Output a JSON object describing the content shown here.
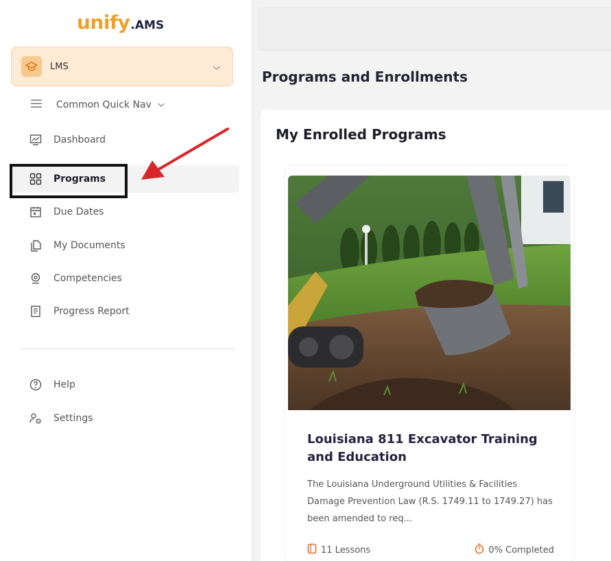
{
  "logo": {
    "main": "unify",
    "sub": ".AMS"
  },
  "module_select": {
    "label": "LMS",
    "icon": "graduation-cap-icon"
  },
  "quick_nav": {
    "label": "Common Quick Nav"
  },
  "nav": [
    {
      "label": "Dashboard",
      "icon": "dashboard-chart-icon"
    },
    {
      "label": "Programs",
      "icon": "grid-icon",
      "active": true
    },
    {
      "label": "Due Dates",
      "icon": "calendar-icon"
    },
    {
      "label": "My Documents",
      "icon": "documents-icon"
    },
    {
      "label": "Competencies",
      "icon": "badge-icon"
    },
    {
      "label": "Progress Report",
      "icon": "report-icon"
    }
  ],
  "nav_bottom": [
    {
      "label": "Help",
      "icon": "help-circle-icon"
    },
    {
      "label": "Settings",
      "icon": "settings-users-icon"
    }
  ],
  "page": {
    "title": "Programs and Enrollments"
  },
  "panel": {
    "title": "My Enrolled Programs"
  },
  "card": {
    "title": "Louisiana 811 Excavator Training and Education",
    "description": "The Louisiana Underground Utilities & Facilities Damage Prevention Law (R.S. 1749.11 to 1749.27) has been amended to req...",
    "lessons": "11  Lessons",
    "completed": "0% Completed",
    "image": "excavator-digging-photo"
  },
  "colors": {
    "brand_orange": "#f0a12b",
    "brand_navy": "#1f2340",
    "annotation_red": "#d9262b",
    "module_bg": "#fdebd6"
  }
}
